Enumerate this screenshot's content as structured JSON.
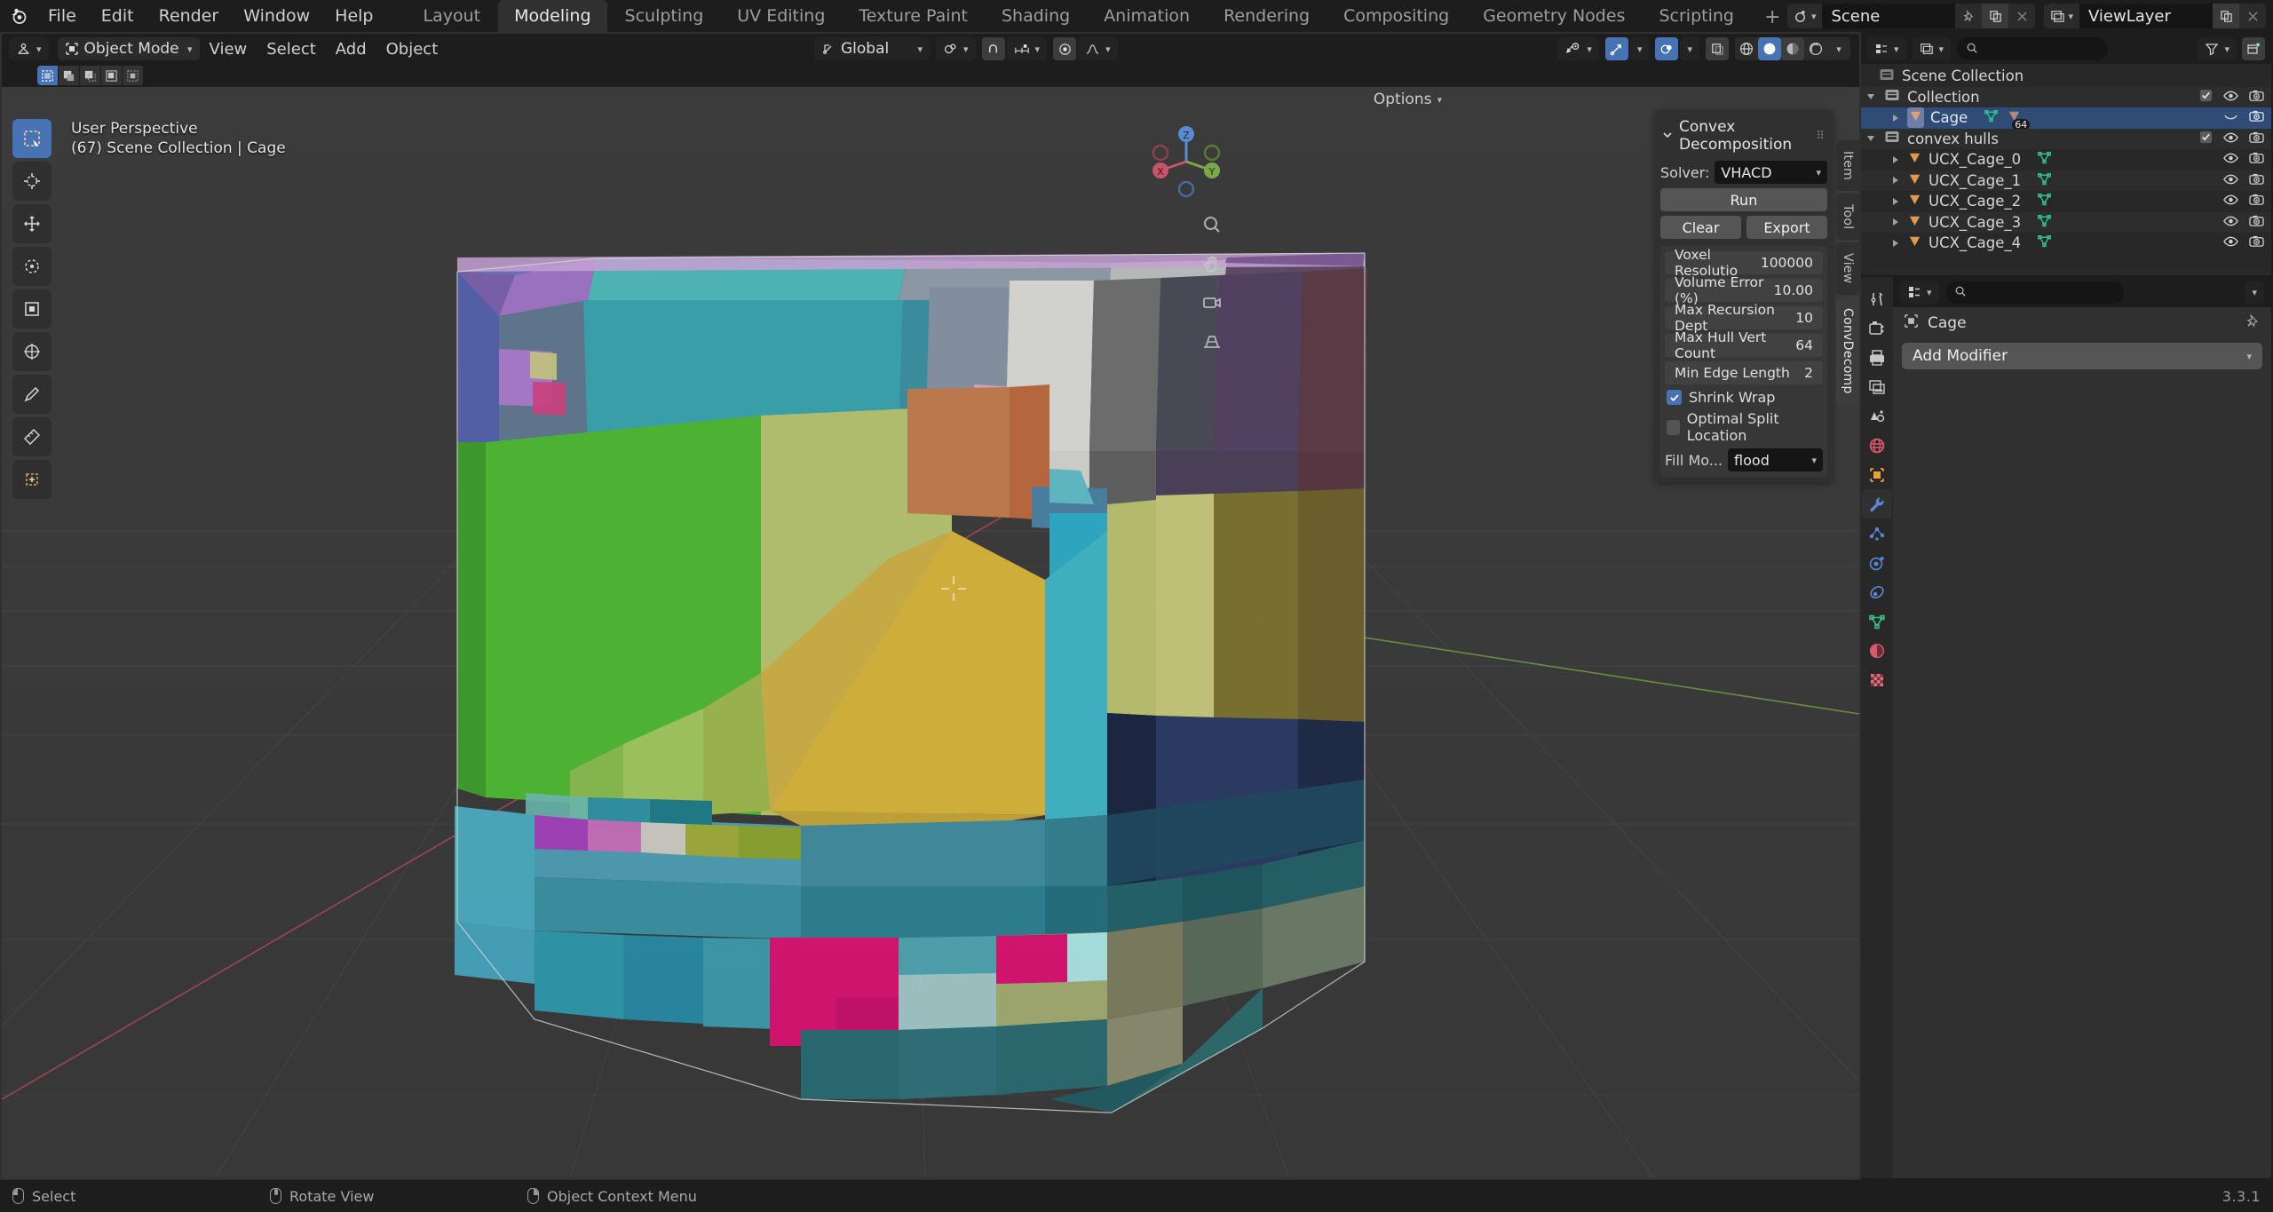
{
  "app": {
    "version": "3.3.1",
    "accent": "#4772b3",
    "bg": "#1d1d1d"
  },
  "topbar": {
    "logo_icon": "blender-logo-icon",
    "menus": [
      "File",
      "Edit",
      "Render",
      "Window",
      "Help"
    ],
    "workspaces": [
      {
        "label": "Layout",
        "active": false
      },
      {
        "label": "Modeling",
        "active": true
      },
      {
        "label": "Sculpting",
        "active": false
      },
      {
        "label": "UV Editing",
        "active": false
      },
      {
        "label": "Texture Paint",
        "active": false
      },
      {
        "label": "Shading",
        "active": false
      },
      {
        "label": "Animation",
        "active": false
      },
      {
        "label": "Rendering",
        "active": false
      },
      {
        "label": "Compositing",
        "active": false
      },
      {
        "label": "Geometry Nodes",
        "active": false
      },
      {
        "label": "Scripting",
        "active": false
      }
    ],
    "add_workspace_label": "+",
    "scene": {
      "name": "Scene",
      "icon": "scene-icon",
      "pin_icon": "pin-icon",
      "copy_icon": "duplicate-icon",
      "close_icon": "x-icon"
    },
    "viewlayer": {
      "name": "ViewLayer",
      "icon": "view-layer-icon",
      "copy_icon": "duplicate-icon",
      "close_icon": "x-icon"
    }
  },
  "viewport": {
    "header": {
      "editor_type_icon": "editor-type-3dview-icon",
      "mode": "Object Mode",
      "mode_icon": "object-mode-icon",
      "menus": [
        "View",
        "Select",
        "Add",
        "Object"
      ],
      "transform_orientation": "Global",
      "orientation_icon": "orientation-icon",
      "snap_icon": "magnet-icon",
      "snap_target_icon": "snap-increment-icon",
      "proportional_icon": "proportional-edit-icon",
      "proportional_falloff_icon": "falloff-smooth-icon",
      "visibility_icon": "object-visibility-icon",
      "gizmo_icon": "gizmo-icon",
      "overlays_icon": "overlays-icon",
      "xray_icon": "xray-icon",
      "shading_modes": [
        "wireframe",
        "solid",
        "material-preview",
        "rendered"
      ],
      "shading_active": "solid"
    },
    "select_modes": [
      "select-box-icon",
      "select-extend-icon",
      "select-subtract-icon",
      "select-invert-icon",
      "select-intersect-icon"
    ],
    "select_mode_active": 0,
    "toolbar": [
      {
        "icon": "tweak-select-box-icon",
        "active": true
      },
      {
        "icon": "cursor-icon",
        "active": false
      },
      {
        "icon": "move-icon",
        "active": false
      },
      {
        "icon": "rotate-icon",
        "active": false
      },
      {
        "icon": "scale-icon",
        "active": false
      },
      {
        "icon": "transform-icon",
        "active": false
      },
      {
        "icon": "annotate-icon",
        "active": false
      },
      {
        "icon": "measure-icon",
        "active": false
      },
      {
        "icon": "add-cube-icon",
        "active": false
      }
    ],
    "overlay_text_line1": "User Perspective",
    "overlay_text_line2": "(67) Scene Collection | Cage",
    "options_label": "Options",
    "gizmo_axes": [
      "X",
      "Y",
      "Z"
    ],
    "nav_icons": [
      "zoom-icon",
      "pan-hand-icon",
      "camera-view-icon",
      "ortho-persp-toggle-icon"
    ],
    "side_tabs": [
      {
        "label": "Item",
        "selected": false
      },
      {
        "label": "Tool",
        "selected": false
      },
      {
        "label": "View",
        "selected": false
      },
      {
        "label": "ConvDecomp",
        "selected": true
      }
    ]
  },
  "convex_decomposition": {
    "title": "Convex Decomposition",
    "collapse_icon": "chevron-down-icon",
    "grip_icon": "panel-grip-icon",
    "solver_label": "Solver:",
    "solver_value": "VHACD",
    "run_label": "Run",
    "clear_label": "Clear",
    "export_label": "Export",
    "properties": [
      {
        "label": "Voxel Resolutio",
        "value": "100000"
      },
      {
        "label": "Volume Error (%)",
        "value": "10.00"
      },
      {
        "label": "Max Recursion Dept",
        "value": "10"
      },
      {
        "label": "Max Hull Vert Count",
        "value": "64"
      },
      {
        "label": "Min Edge Length",
        "value": "2"
      }
    ],
    "checkboxes": [
      {
        "label": "Shrink Wrap",
        "checked": true
      },
      {
        "label": "Optimal Split Location",
        "checked": false
      }
    ],
    "fill_mode_label": "Fill Mo...",
    "fill_mode_value": "flood"
  },
  "outliner": {
    "display_mode_icon": "outliner-display-mode-icon",
    "scene_filter_icon": "view-layer-icon",
    "search_placeholder": "",
    "search_icon": "search-icon",
    "filter_icon": "filter-funnel-icon",
    "new_collection_icon": "new-collection-icon",
    "rows": [
      {
        "indent": 0,
        "icon": "scene-collection-icon",
        "label": "Scene Collection",
        "expander": "none",
        "checkbox": false,
        "eye": false,
        "camera": false,
        "selected": false
      },
      {
        "indent": 1,
        "icon": "collection-icon",
        "label": "Collection",
        "expander": "down",
        "checkbox": true,
        "eye": true,
        "camera": true,
        "selected": false
      },
      {
        "indent": 2,
        "icon": "mesh-object-icon",
        "label": "Cage",
        "expander": "right",
        "checkbox": false,
        "eye": false,
        "camera": true,
        "selected": true,
        "badge": "64",
        "mesh_data_icon": "mesh-data-icon",
        "modifier_icon": "mesh-object-icon",
        "collapsed_eye": true
      },
      {
        "indent": 1,
        "icon": "collection-icon",
        "label": "convex hulls",
        "expander": "down",
        "checkbox": true,
        "eye": true,
        "camera": true,
        "selected": false
      },
      {
        "indent": 2,
        "icon": "mesh-object-icon",
        "label": "UCX_Cage_0",
        "expander": "right",
        "eye": true,
        "camera": true,
        "selected": false,
        "mesh_data_icon": "mesh-data-icon"
      },
      {
        "indent": 2,
        "icon": "mesh-object-icon",
        "label": "UCX_Cage_1",
        "expander": "right",
        "eye": true,
        "camera": true,
        "selected": false,
        "mesh_data_icon": "mesh-data-icon"
      },
      {
        "indent": 2,
        "icon": "mesh-object-icon",
        "label": "UCX_Cage_2",
        "expander": "right",
        "eye": true,
        "camera": true,
        "selected": false,
        "mesh_data_icon": "mesh-data-icon"
      },
      {
        "indent": 2,
        "icon": "mesh-object-icon",
        "label": "UCX_Cage_3",
        "expander": "right",
        "eye": true,
        "camera": true,
        "selected": false,
        "mesh_data_icon": "mesh-data-icon"
      },
      {
        "indent": 2,
        "icon": "mesh-object-icon",
        "label": "UCX_Cage_4",
        "expander": "right",
        "eye": true,
        "camera": true,
        "selected": false,
        "mesh_data_icon": "mesh-data-icon"
      }
    ]
  },
  "properties": {
    "editor_icon": "properties-editor-icon",
    "search_icon": "search-icon",
    "search_placeholder": "",
    "options_chevron": "chevron-down-icon",
    "breadcrumb_icon": "object-icon",
    "breadcrumb": "Cage",
    "pin_icon": "pin-icon",
    "add_modifier_label": "Add Modifier",
    "add_modifier_chevron": "chevron-down-icon",
    "tabs": [
      {
        "name": "tool",
        "icon": "tool-wrench-screwdriver-icon",
        "active": false,
        "color": "#c8c8c8"
      },
      {
        "name": "render",
        "icon": "render-camera-back-icon",
        "active": false,
        "color": "#c8c8c8"
      },
      {
        "name": "output",
        "icon": "output-printer-icon",
        "active": false,
        "color": "#c8c8c8"
      },
      {
        "name": "view-layer",
        "icon": "view-layer-images-icon",
        "active": false,
        "color": "#c8c8c8"
      },
      {
        "name": "scene",
        "icon": "scene-cone-sphere-icon",
        "active": false,
        "color": "#c8c8c8"
      },
      {
        "name": "world",
        "icon": "world-globe-icon",
        "active": false,
        "color": "#e0576d"
      },
      {
        "name": "object",
        "icon": "object-square-icon",
        "active": false,
        "color": "#e8a33d"
      },
      {
        "name": "modifiers",
        "icon": "wrench-icon",
        "active": true,
        "color": "#5a87d8"
      },
      {
        "name": "particles",
        "icon": "particles-icon",
        "active": false,
        "color": "#5a87d8"
      },
      {
        "name": "physics",
        "icon": "physics-orbit-icon",
        "active": false,
        "color": "#5a87d8"
      },
      {
        "name": "constraints",
        "icon": "constraints-icon",
        "active": false,
        "color": "#5a87d8"
      },
      {
        "name": "data",
        "icon": "mesh-data-icon",
        "active": false,
        "color": "#3dbd8e"
      },
      {
        "name": "material",
        "icon": "material-sphere-icon",
        "active": false,
        "color": "#d85a6a"
      },
      {
        "name": "texture",
        "icon": "texture-checker-icon",
        "active": false,
        "color": "#d85a6a"
      }
    ]
  },
  "statusbar": {
    "items": [
      {
        "mouse": "left",
        "label": "Select"
      },
      {
        "mouse": "middle",
        "label": "Rotate View"
      },
      {
        "mouse": "right",
        "label": "Object Context Menu"
      }
    ],
    "version": "3.3.1"
  },
  "scene_3d": {
    "description": "Convex decomposition result: a large cube-shaped cage mesh split into many colored convex hull pieces",
    "cursor_icon": "3d-cursor-icon",
    "grid": true,
    "axis_x_color": "#c7576b",
    "axis_y_color": "#88b04b"
  }
}
